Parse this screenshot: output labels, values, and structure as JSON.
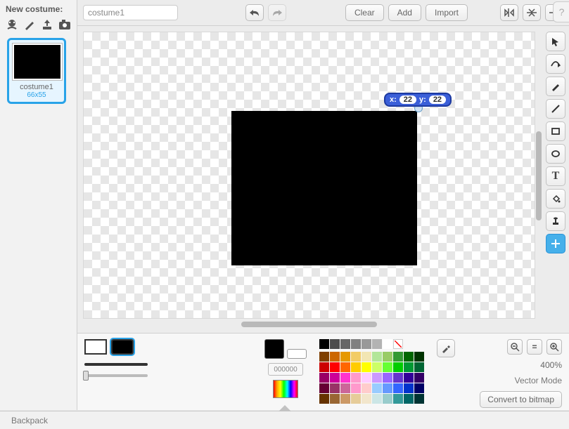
{
  "left": {
    "new_costume_label": "New costume:",
    "thumb": {
      "name": "costume1",
      "dimensions": "66x55"
    }
  },
  "topbar": {
    "name_value": "costume1",
    "clear": "Clear",
    "add": "Add",
    "import": "Import"
  },
  "canvas": {
    "x_label": "x:",
    "y_label": "y:",
    "x_value": "22",
    "y_value": "22"
  },
  "palette": {
    "hex": "000000",
    "zoom_pct": "400%",
    "mode_label": "Vector Mode",
    "convert_label": "Convert to bitmap",
    "grays": [
      "#000000",
      "#4d4d4d",
      "#666666",
      "#808080",
      "#999999",
      "#b3b3b3",
      "#ffffff"
    ],
    "colors": [
      [
        "#7f3f00",
        "#cc6600",
        "#e69900",
        "#f2cc66",
        "#f2e6b3",
        "#b3e699",
        "#99cc66",
        "#339933",
        "#006600",
        "#003300"
      ],
      [
        "#cc0000",
        "#ff0000",
        "#ff6600",
        "#ffcc00",
        "#ffff00",
        "#ccff66",
        "#66ff33",
        "#00cc00",
        "#009933",
        "#006633"
      ],
      [
        "#990066",
        "#cc0099",
        "#ff33cc",
        "#ff99cc",
        "#ffccff",
        "#cc99ff",
        "#9966ff",
        "#6633cc",
        "#330099",
        "#330066"
      ],
      [
        "#660033",
        "#993366",
        "#cc6699",
        "#ff99cc",
        "#ffcccc",
        "#99ccff",
        "#6699ff",
        "#3366ff",
        "#0033cc",
        "#000066"
      ],
      [
        "#663300",
        "#996633",
        "#cc9966",
        "#e6cc99",
        "#f2e6cc",
        "#cce6e6",
        "#99cccc",
        "#339999",
        "#006666",
        "#003333"
      ]
    ]
  },
  "footer": {
    "backpack_label": "Backpack"
  }
}
